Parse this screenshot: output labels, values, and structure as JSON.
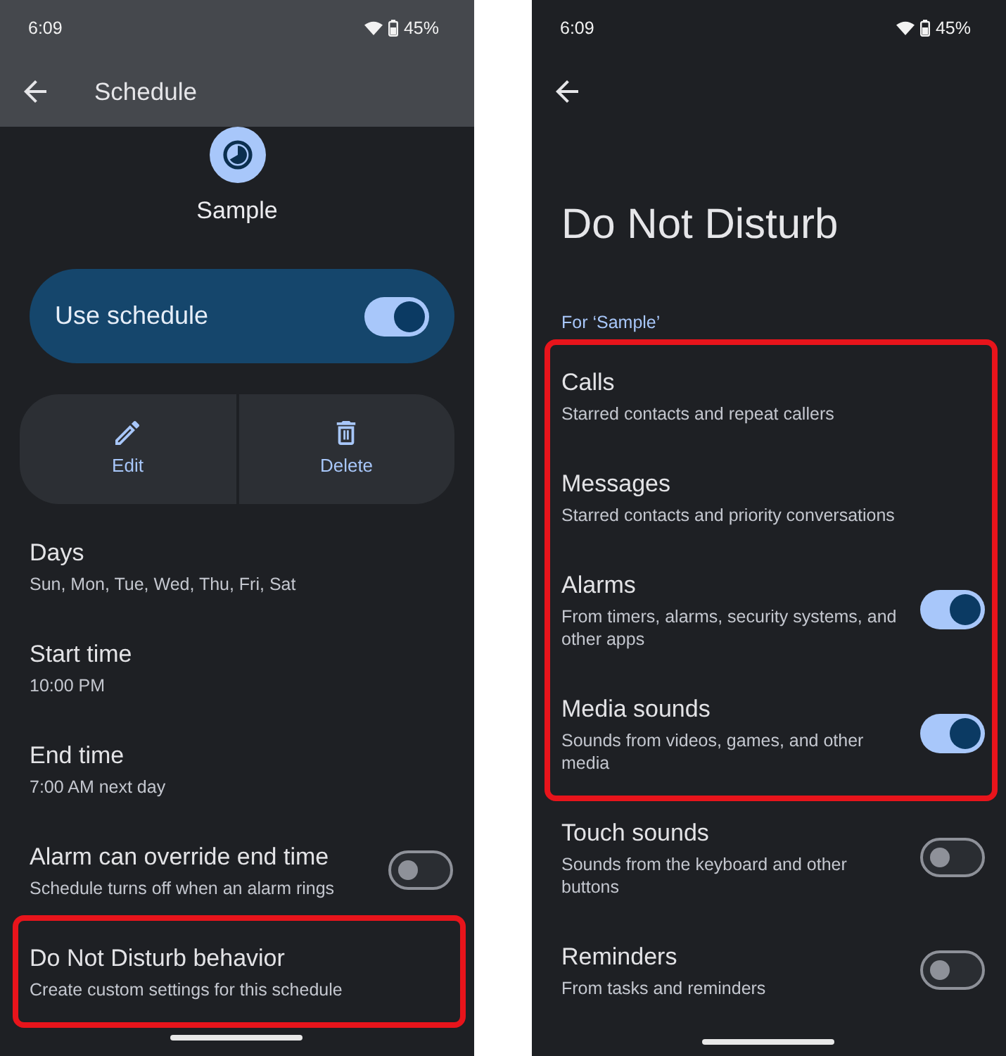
{
  "schedule_screen": {
    "status_bar": {
      "time": "6:09",
      "battery": "45%"
    },
    "app_bar": {
      "title": "Schedule"
    },
    "header": {
      "name": "Sample"
    },
    "main_switch": {
      "label": "Use schedule",
      "on": true
    },
    "actions": [
      {
        "kind": "edit",
        "label": "Edit"
      },
      {
        "kind": "delete",
        "label": "Delete"
      }
    ],
    "items": [
      {
        "kind": "text",
        "title": "Days",
        "subtitle": "Sun, Mon, Tue, Wed, Thu, Fri, Sat",
        "highlighted": false
      },
      {
        "kind": "text",
        "title": "Start time",
        "subtitle": "10:00 PM",
        "highlighted": false
      },
      {
        "kind": "text",
        "title": "End time",
        "subtitle": "7:00 AM next day",
        "highlighted": false
      },
      {
        "kind": "switch",
        "title": "Alarm can override end time",
        "subtitle": "Schedule turns off when an alarm rings",
        "on": false,
        "highlighted": false
      },
      {
        "kind": "text",
        "title": "Do Not Disturb behavior",
        "subtitle": "Create custom settings for this schedule",
        "highlighted": true
      }
    ]
  },
  "dnd_screen": {
    "status_bar": {
      "time": "6:09",
      "battery": "45%"
    },
    "title": "Do Not Disturb",
    "section_label": "For ‘Sample’",
    "items": [
      {
        "kind": "text",
        "title": "Calls",
        "subtitle": "Starred contacts and repeat callers",
        "highlighted": true
      },
      {
        "kind": "text",
        "title": "Messages",
        "subtitle": "Starred contacts and priority conversations",
        "highlighted": true
      },
      {
        "kind": "switch",
        "title": "Alarms",
        "subtitle": "From timers, alarms, security systems, and other apps",
        "on": true,
        "highlighted": true
      },
      {
        "kind": "switch",
        "title": "Media sounds",
        "subtitle": "Sounds from videos, games, and other media",
        "on": true,
        "highlighted": true
      },
      {
        "kind": "switch",
        "title": "Touch sounds",
        "subtitle": "Sounds from the keyboard and other buttons",
        "on": false,
        "highlighted": false
      },
      {
        "kind": "switch",
        "title": "Reminders",
        "subtitle": "From tasks and reminders",
        "on": false,
        "highlighted": false
      }
    ]
  }
}
